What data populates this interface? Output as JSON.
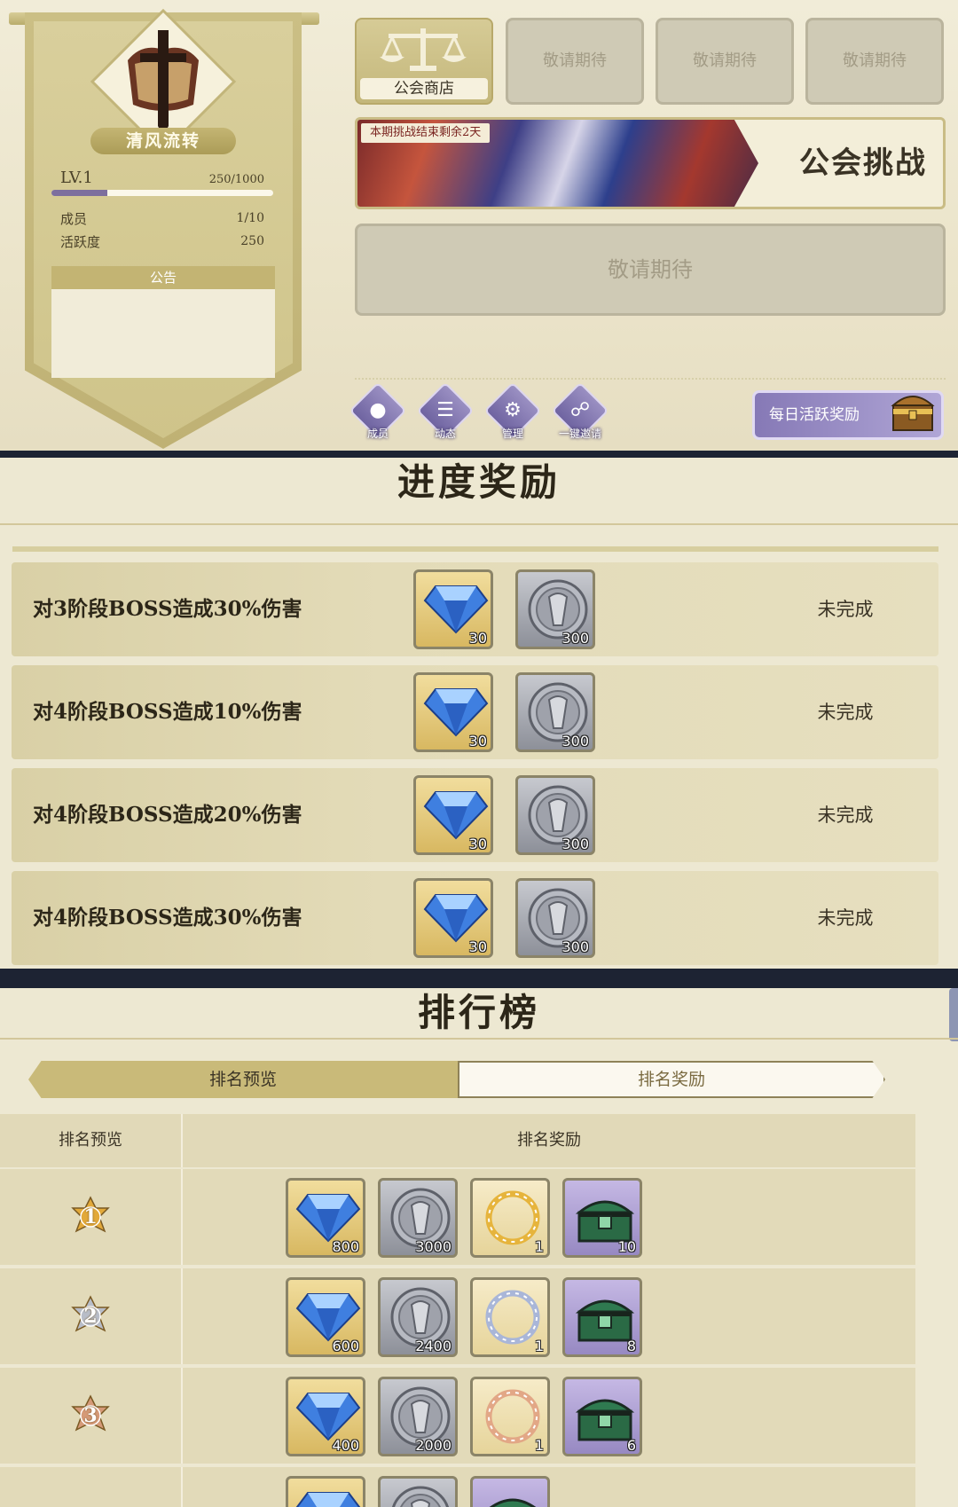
{
  "guild": {
    "name": "清风流转",
    "level_label": "LV.1",
    "exp": "250/1000",
    "exp_fraction": 0.25,
    "members_label": "成员",
    "members_value": "1/10",
    "activity_label": "活跃度",
    "activity_value": "250",
    "notice_title": "公告"
  },
  "top_buttons": {
    "shop": "公会商店",
    "soon_1": "敬请期待",
    "soon_2": "敬请期待",
    "soon_3": "敬请期待",
    "soon_wide": "敬请期待"
  },
  "challenge": {
    "tag": "本期挑战结束剩余2天",
    "title": "公会挑战"
  },
  "nav": [
    {
      "label": "成员",
      "icon": "member-icon"
    },
    {
      "label": "动态",
      "icon": "news-icon"
    },
    {
      "label": "管理",
      "icon": "settings-icon"
    },
    {
      "label": "一键邀请",
      "icon": "handshake-icon"
    }
  ],
  "daily_reward": "每日活跃奖励",
  "progress": {
    "title": "进度奖励",
    "tasks": [
      {
        "text": "对3阶段BOSS造成30%伤害",
        "gem": "30",
        "coin": "300",
        "status": "未完成"
      },
      {
        "text": "对4阶段BOSS造成10%伤害",
        "gem": "30",
        "coin": "300",
        "status": "未完成"
      },
      {
        "text": "对4阶段BOSS造成20%伤害",
        "gem": "30",
        "coin": "300",
        "status": "未完成"
      },
      {
        "text": "对4阶段BOSS造成30%伤害",
        "gem": "30",
        "coin": "300",
        "status": "未完成"
      }
    ]
  },
  "leaderboard": {
    "title": "排行榜",
    "tab_preview": "排名预览",
    "tab_reward": "排名奖励",
    "col_rank": "排名预览",
    "col_reward": "排名奖励",
    "rows": [
      {
        "rank": "1",
        "gem": "800",
        "coin": "3000",
        "ring": "1",
        "chest": "10"
      },
      {
        "rank": "2",
        "gem": "600",
        "coin": "2400",
        "ring": "1",
        "chest": "8"
      },
      {
        "rank": "3",
        "gem": "400",
        "coin": "2000",
        "ring": "1",
        "chest": "6"
      }
    ]
  },
  "colors": {
    "accent_purple": "#7d6f9e",
    "gold": "#c9ba79",
    "rank1": "#e2a93a",
    "rank2": "#b8bdc8",
    "rank3": "#d59a78"
  }
}
